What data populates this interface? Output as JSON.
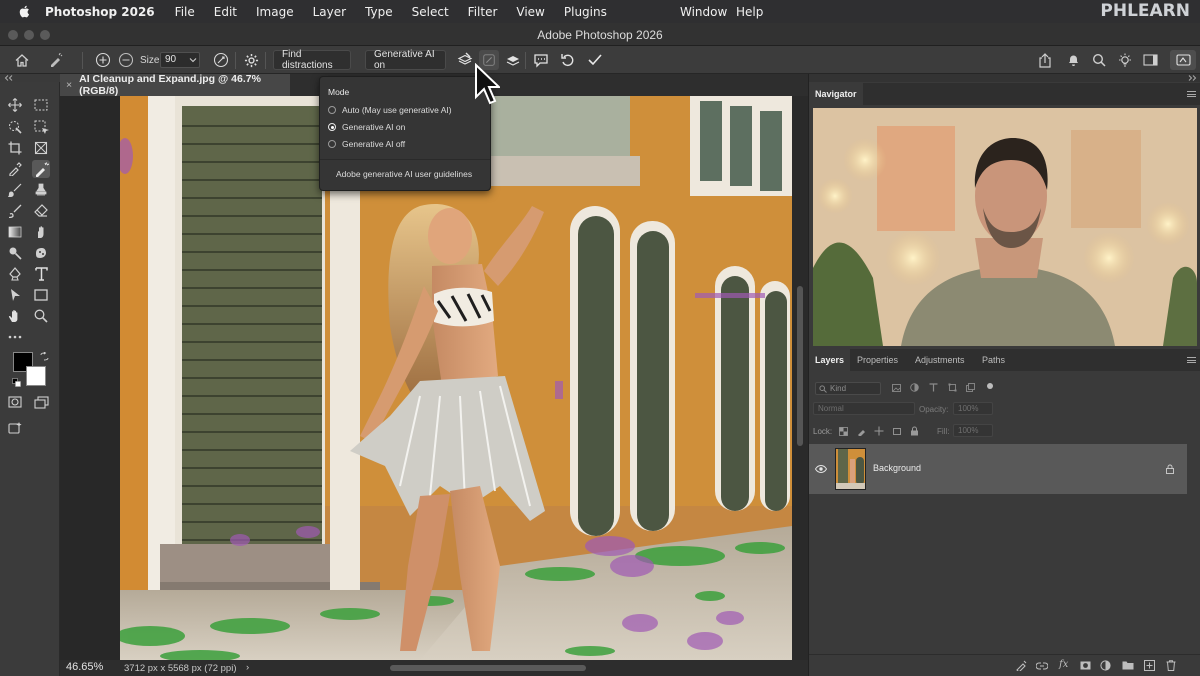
{
  "menubar": {
    "app_name": "Photoshop 2026",
    "items": [
      "File",
      "Edit",
      "Image",
      "Layer",
      "Type",
      "Select",
      "Filter",
      "View",
      "Plugins"
    ],
    "right_items": [
      "Window",
      "Help"
    ]
  },
  "watermark": "PHLEARN",
  "window": {
    "title": "Adobe Photoshop 2026"
  },
  "options_bar": {
    "size_label": "Size",
    "size_value": "90",
    "find_distractions_label": "Find distractions",
    "gen_ai_dropdown_label": "Generative AI on"
  },
  "document": {
    "tab_title": "AI Cleanup and Expand.jpg @ 46.7% (RGB/8)",
    "close_glyph": "×"
  },
  "mode_popover": {
    "heading": "Mode",
    "options": [
      {
        "label": "Auto (May use generative AI)",
        "selected": false
      },
      {
        "label": "Generative AI on",
        "selected": true
      },
      {
        "label": "Generative AI off",
        "selected": false
      }
    ],
    "link_label": "Adobe generative AI user guidelines"
  },
  "status": {
    "zoom": "46.65%",
    "dimensions": "3712 px x 5568 px (72 ppi)",
    "arrow": "›"
  },
  "navigator": {
    "tab": "Navigator"
  },
  "layers_panel": {
    "tabs": [
      "Layers",
      "Properties",
      "Adjustments",
      "Paths"
    ],
    "kind_placeholder": "Kind",
    "blend_mode": "Normal",
    "opacity_label": "Opacity:",
    "opacity_value": "100%",
    "lock_label": "Lock:",
    "fill_label": "Fill:",
    "fill_value": "100%",
    "layers": [
      {
        "name": "Background",
        "visible": true,
        "locked": true
      }
    ]
  },
  "colors": {
    "accent_mask": "#a05ab4",
    "accent_green": "#3ca03c",
    "panel_bg": "#3a3a3a"
  }
}
